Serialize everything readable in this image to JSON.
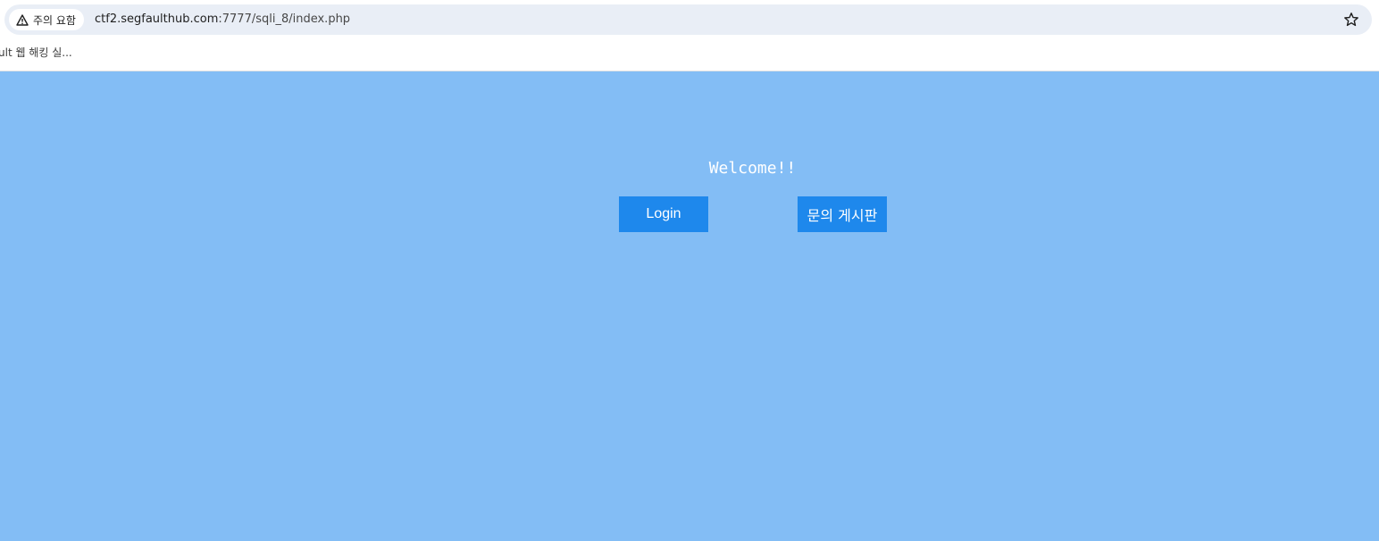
{
  "browser": {
    "security_chip": "주의 요함",
    "url_host": "ctf2.segfaulthub.com",
    "url_rest": ":7777/sqli_8/index.php",
    "bookmark_label": "ult 웹 해킹 실..."
  },
  "page": {
    "background": "#83bdf5",
    "welcome": "Welcome!!",
    "login_button": "Login",
    "board_button": "문의 게시판",
    "button_color": "#1e88ec"
  }
}
